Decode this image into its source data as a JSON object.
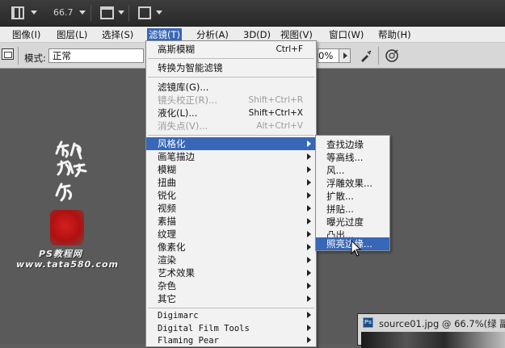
{
  "appbar": {
    "zoom": "66.7"
  },
  "menubar": [
    {
      "label": "图像(I)"
    },
    {
      "label": "图层(L)"
    },
    {
      "label": "选择(S)"
    },
    {
      "label": "滤镜(T)"
    },
    {
      "label": "分析(A)"
    },
    {
      "label": "3D(D)"
    },
    {
      "label": "视图(V)"
    },
    {
      "label": "窗口(W)"
    },
    {
      "label": "帮助(H)"
    }
  ],
  "options": {
    "mode_label": "模式:",
    "mode_value": "正常",
    "percent": "0%"
  },
  "filter_menu": {
    "last_filter": {
      "label": "高斯模糊",
      "shortcut": "Ctrl+F"
    },
    "convert_smart": {
      "label": "转换为智能滤镜"
    },
    "gallery": {
      "label": "滤镜库(G)..."
    },
    "lens_correction": {
      "label": "镜头校正(R)...",
      "shortcut": "Shift+Ctrl+R"
    },
    "liquify": {
      "label": "液化(L)...",
      "shortcut": "Shift+Ctrl+X"
    },
    "vanishing_point": {
      "label": "消失点(V)...",
      "shortcut": "Alt+Ctrl+V"
    },
    "groups": [
      {
        "label": "风格化"
      },
      {
        "label": "画笔描边"
      },
      {
        "label": "模糊"
      },
      {
        "label": "扭曲"
      },
      {
        "label": "锐化"
      },
      {
        "label": "视频"
      },
      {
        "label": "素描"
      },
      {
        "label": "纹理"
      },
      {
        "label": "像素化"
      },
      {
        "label": "渲染"
      },
      {
        "label": "艺术效果"
      },
      {
        "label": "杂色"
      },
      {
        "label": "其它"
      }
    ],
    "plugins": [
      {
        "label": "Digimarc"
      },
      {
        "label": "Digital Film Tools"
      },
      {
        "label": "Flaming Pear"
      }
    ]
  },
  "stylize_submenu": [
    {
      "label": "查找边缘"
    },
    {
      "label": "等高线..."
    },
    {
      "label": "风..."
    },
    {
      "label": "浮雕效果..."
    },
    {
      "label": "扩散..."
    },
    {
      "label": "拼贴..."
    },
    {
      "label": "曝光过度"
    },
    {
      "label": "凸出..."
    },
    {
      "label": "照亮边缘..."
    }
  ],
  "watermark": {
    "site_name": "PS教程网",
    "site_url": "www.tata580.com"
  },
  "document": {
    "ps_badge": "Ps",
    "title": "source01.jpg @ 66.7%(绿 副"
  },
  "colors": {
    "highlight": "#3867b8",
    "seal_red": "#c41818"
  }
}
